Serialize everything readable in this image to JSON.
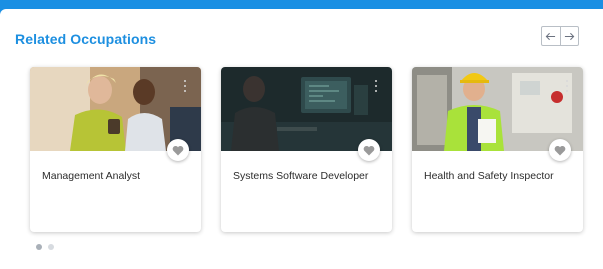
{
  "section": {
    "title": "Related Occupations"
  },
  "icons": {
    "prev": "arrow-left-icon",
    "next": "arrow-right-icon",
    "favorite": "heart-icon",
    "menu": "kebab-menu-icon"
  },
  "colors": {
    "top_bar": "#1a8fe3",
    "title": "#1d8fe0",
    "favorite_icon": "#9a9a9a"
  },
  "cards": [
    {
      "title": "Management Analyst"
    },
    {
      "title": "Systems Software Developer"
    },
    {
      "title": "Health and Safety Inspector"
    }
  ],
  "pagination": {
    "pages": 2,
    "current": 1
  }
}
